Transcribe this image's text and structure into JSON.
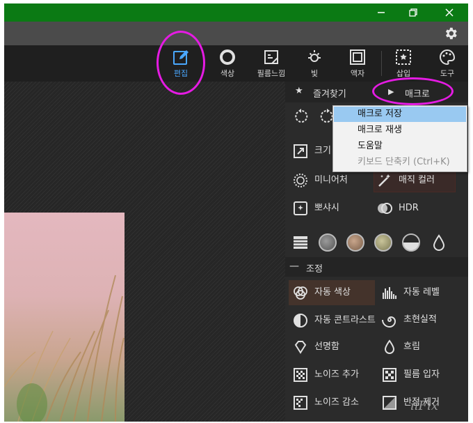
{
  "titlebar": {
    "accent": "#0b7a14"
  },
  "toolbar": {
    "tools": [
      {
        "label": "편집",
        "icon": "edit-icon"
      },
      {
        "label": "색상",
        "icon": "color-ring-icon"
      },
      {
        "label": "필름느낌",
        "icon": "film-icon"
      },
      {
        "label": "빛",
        "icon": "light-icon"
      },
      {
        "label": "액자",
        "icon": "frame-icon"
      },
      {
        "label": "삽입",
        "icon": "insert-icon"
      },
      {
        "label": "도구",
        "icon": "tools-palette-icon"
      }
    ],
    "active_color": "#4aa8ff"
  },
  "panel": {
    "favorites_label": "즐겨찾기",
    "macro_label": "매크로",
    "tools": {
      "resize": "크기",
      "miniature": "미니어처",
      "magic_color": "매직 컬러",
      "soft": "뽀샤시",
      "hdr": "HDR"
    },
    "adjust_section": {
      "label": "조정",
      "items": {
        "auto_color": "자동 색상",
        "auto_level": "자동 레벨",
        "auto_contrast": "자동 콘트라스트",
        "surreal": "초현실적",
        "sharpen": "선명함",
        "blur": "흐림",
        "add_noise": "노이즈 추가",
        "film_grain": "필름 입자",
        "reduce_noise": "노이즈 감소",
        "remove_halftone": "반점 제거"
      }
    }
  },
  "macro_menu": {
    "items": [
      {
        "label": "매크로 저장",
        "highlighted": true
      },
      {
        "label": "매크로 재생"
      },
      {
        "label": "도움말"
      },
      {
        "label": "키보드 단축키 (Ctrl+K)",
        "disabled": true
      }
    ]
  },
  "annotation_color": "#e51be3",
  "watermark": "iiFix"
}
